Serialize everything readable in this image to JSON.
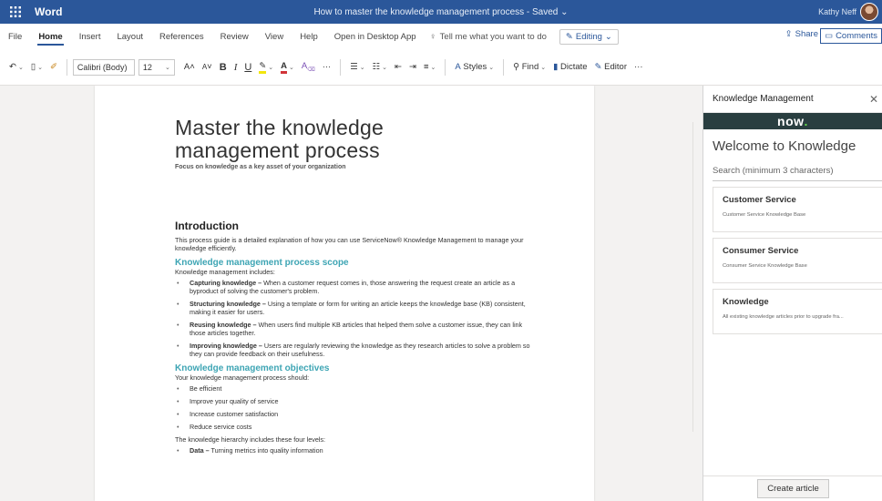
{
  "titlebar": {
    "app_name": "Word",
    "doc_title": "How to master the knowledge management process - Saved",
    "user_name": "Kathy Neff"
  },
  "menu": {
    "items": [
      "File",
      "Home",
      "Insert",
      "Layout",
      "References",
      "Review",
      "View",
      "Help",
      "Open in Desktop App"
    ],
    "active": "Home",
    "tell_me": "Tell me what you want to do",
    "editing": "Editing",
    "share": "Share",
    "comments": "Comments"
  },
  "toolbar": {
    "font_name": "Calibri (Body)",
    "font_size": "12",
    "bold": "B",
    "italic": "I",
    "underline": "U",
    "grow_font": "A",
    "shrink_font": "A",
    "more": "···",
    "styles": "Styles",
    "find": "Find",
    "dictate": "Dictate",
    "editor": "Editor",
    "overflow": "···"
  },
  "document": {
    "title": "Master the knowledge management process",
    "subtitle": "Focus on knowledge as a key asset of your organization",
    "intro_heading": "Introduction",
    "intro_text": "This process guide is a detailed explanation of how you can use ServiceNow® Knowledge Management to manage your knowledge efficiently.",
    "scope_heading": "Knowledge management process scope",
    "scope_lead": "Knowledge management includes:",
    "scope_items": [
      {
        "bold": "Capturing knowledge –",
        "text": " When a customer request comes in, those answering the request create an article as a byproduct of solving the customer's problem."
      },
      {
        "bold": "Structuring knowledge –",
        "text": " Using a template or form for writing an article keeps the knowledge base (KB) consistent, making it easier for users."
      },
      {
        "bold": "Reusing knowledge –",
        "text": " When users find multiple KB articles that helped them solve a customer issue, they can link those articles together."
      },
      {
        "bold": "Improving knowledge –",
        "text": " Users are regularly reviewing the knowledge as they research articles to solve a problem so they can provide feedback on their usefulness."
      }
    ],
    "objectives_heading": "Knowledge management objectives",
    "objectives_lead": "Your knowledge management process should:",
    "objectives_items": [
      "Be efficient",
      "Improve your quality of service",
      "Increase customer satisfaction",
      "Reduce service costs"
    ],
    "hierarchy_lead": "The knowledge hierarchy includes these four levels:",
    "hierarchy_items": [
      {
        "bold": "Data –",
        "text": " Turning metrics into quality information"
      }
    ]
  },
  "pane": {
    "header": "Knowledge Management",
    "brand": "now",
    "welcome": "Welcome to Knowledge",
    "search_placeholder": "Search (minimum 3 characters)",
    "knowledge_bases": [
      {
        "title": "Customer Service",
        "desc": "Customer Service Knowledge Base"
      },
      {
        "title": "Consumer Service",
        "desc": "Consumer Service Knowledge Base"
      },
      {
        "title": "Knowledge",
        "desc": "All existing knowledge articles prior to upgrade fra..."
      }
    ],
    "create_button": "Create article"
  },
  "colors": {
    "title_bar": "#2b579a",
    "heading_teal": "#3ea5b4",
    "now_bar": "#293e40",
    "now_dot": "#62d84e"
  }
}
